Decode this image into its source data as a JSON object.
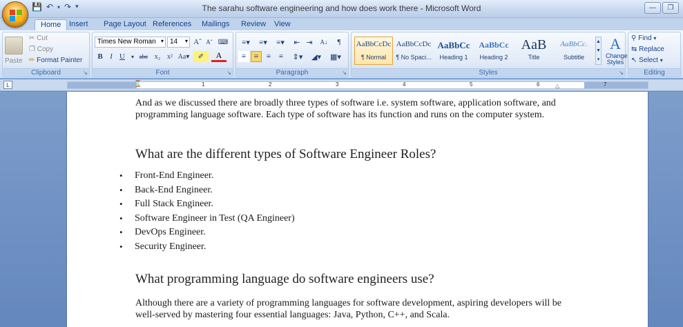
{
  "window": {
    "title": "The sarahu software engineering and how does work there - Microsoft Word"
  },
  "tabs": [
    "Home",
    "Insert",
    "Page Layout",
    "References",
    "Mailings",
    "Review",
    "View"
  ],
  "clipboard": {
    "paste": "Paste",
    "cut": "Cut",
    "copy": "Copy",
    "format_painter": "Format Painter",
    "label": "Clipboard"
  },
  "font": {
    "name": "Times New Roman",
    "size": "14",
    "label": "Font"
  },
  "paragraph": {
    "label": "Paragraph"
  },
  "styles": {
    "label": "Styles",
    "items": [
      {
        "sample": "AaBbCcDc",
        "name": "¶ Normal"
      },
      {
        "sample": "AaBbCcDc",
        "name": "¶ No Spaci..."
      },
      {
        "sample": "AaBbCc",
        "name": "Heading 1"
      },
      {
        "sample": "AaBbCc",
        "name": "Heading 2"
      },
      {
        "sample": "AaB",
        "name": "Title"
      },
      {
        "sample": "AaBbCc.",
        "name": "Subtitle"
      }
    ],
    "change_styles": "Change Styles"
  },
  "editing": {
    "find": "Find",
    "replace": "Replace",
    "select": "Select",
    "label": "Editing"
  },
  "ruler": {
    "numbers": [
      "1",
      "2",
      "3",
      "4",
      "5",
      "6",
      "7"
    ],
    "corner": "L"
  },
  "document": {
    "intro": "And as we discussed there are broadly three types of software i.e. system software, application software, and programming language software. Each type of software has its function and runs on the computer system.",
    "heading1": "What are the different types of Software Engineer Roles?",
    "roles": [
      "Front-End Engineer.",
      "Back-End Engineer.",
      "Full Stack Engineer.",
      "Software Engineer in Test (QA Engineer)",
      "DevOps Engineer.",
      "Security Engineer."
    ],
    "heading2": "What programming language do software engineers use?",
    "closing": "Although there are a variety of programming languages for software development, aspiring developers will be well-served by mastering four essential languages: Java, Python, C++, and Scala."
  }
}
